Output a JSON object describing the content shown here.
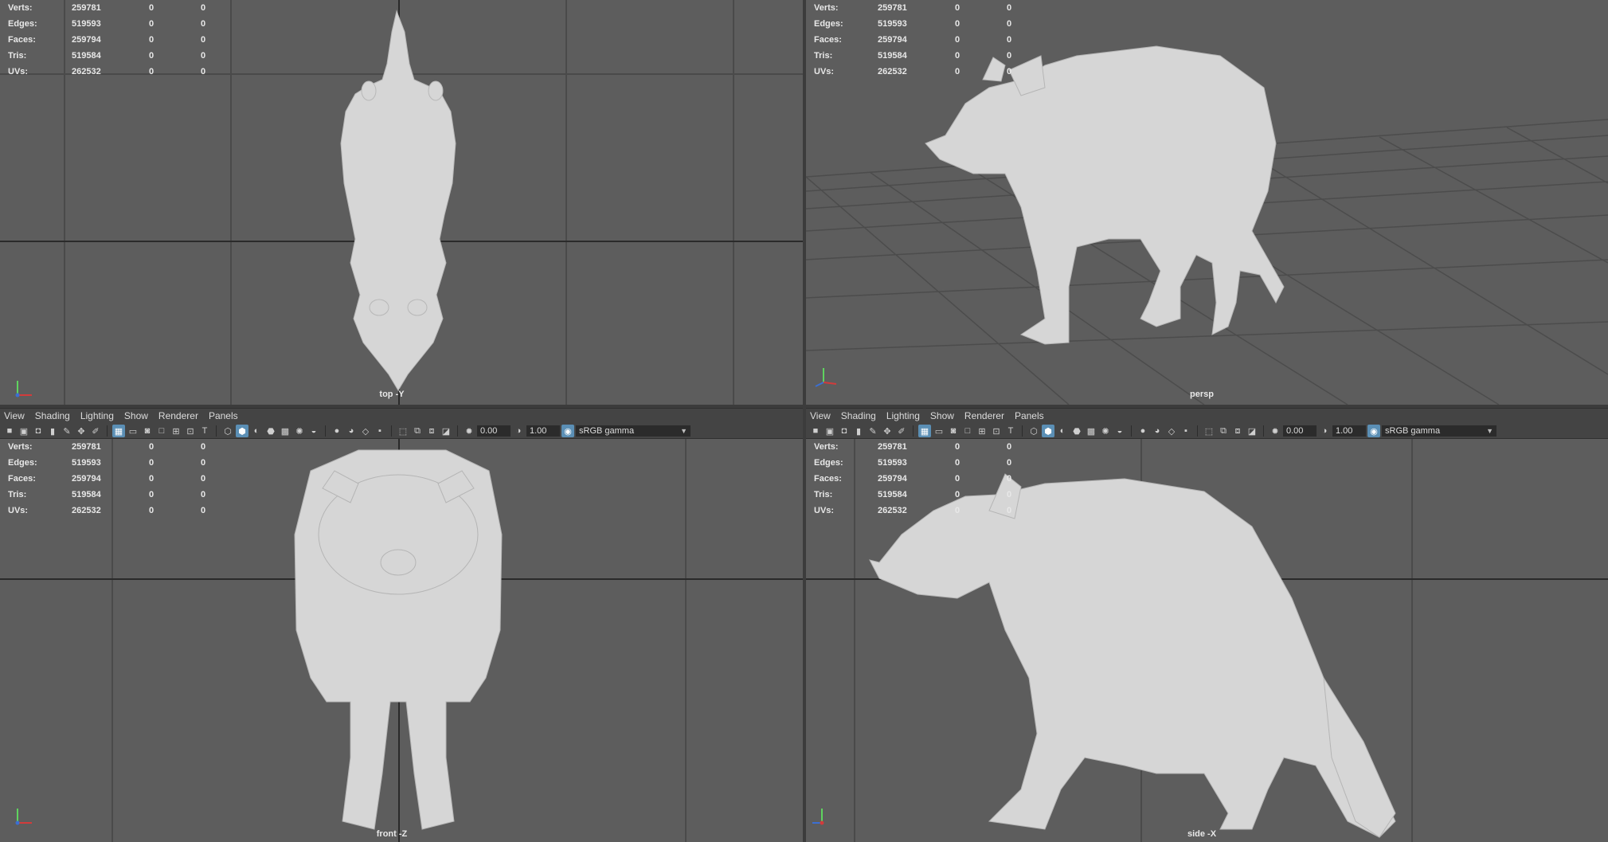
{
  "stats": {
    "rows": [
      {
        "label": "Verts:",
        "value": "259781",
        "sel": "0",
        "tri": "0"
      },
      {
        "label": "Edges:",
        "value": "519593",
        "sel": "0",
        "tri": "0"
      },
      {
        "label": "Faces:",
        "value": "259794",
        "sel": "0",
        "tri": "0"
      },
      {
        "label": "Tris:",
        "value": "519584",
        "sel": "0",
        "tri": "0"
      },
      {
        "label": "UVs:",
        "value": "262532",
        "sel": "0",
        "tri": "0"
      }
    ]
  },
  "viewports": {
    "top": {
      "camera": "top -Y"
    },
    "persp": {
      "camera": "persp"
    },
    "front": {
      "camera": "front -Z"
    },
    "side": {
      "camera": "side -X"
    }
  },
  "panel_menu": {
    "items": [
      "View",
      "Shading",
      "Lighting",
      "Show",
      "Renderer",
      "Panels"
    ]
  },
  "panel_toolbar": {
    "exposure": "0.00",
    "gamma": "1.00",
    "color_space": "sRGB gamma"
  },
  "colors": {
    "viewport_bg": "#5d5d5d",
    "model": "#d6d6d6",
    "toolbar_bg": "#444444",
    "active_tool": "#5b8fb5",
    "axis_x": "#d23b3b",
    "axis_y": "#5fd35f",
    "axis_z": "#3b6fd2"
  },
  "icons": [
    "camera-icon",
    "bookmark-icon",
    "image-plane-icon",
    "grid-icon",
    "film-gate-icon",
    "resolution-gate-icon",
    "wireframe-icon",
    "smooth-shade-icon",
    "textured-icon",
    "lights-icon",
    "shadows-icon",
    "xray-icon",
    "isolate-icon",
    "exposure-icon",
    "gamma-icon",
    "color-management-icon"
  ]
}
